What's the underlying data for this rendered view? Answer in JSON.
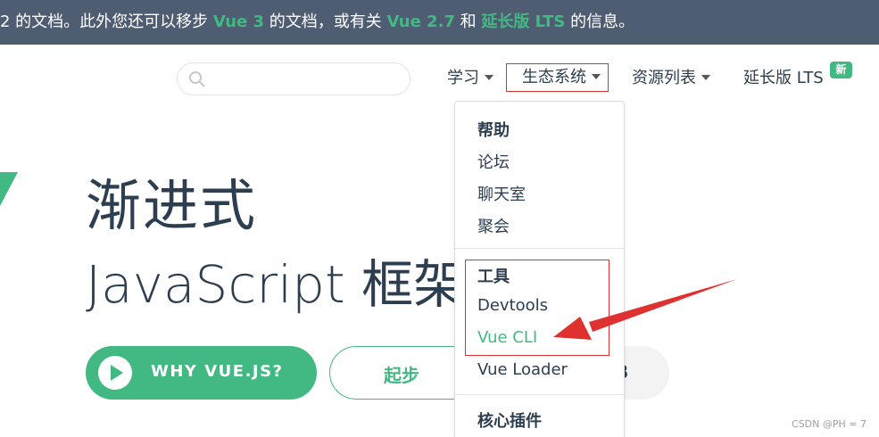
{
  "banner": {
    "part1": "2 的文档。此外您还可以移步 ",
    "link_vue3": "Vue 3",
    "part2": " 的文档，或有关 ",
    "link_vue27": "Vue 2.7",
    "part3": " 和 ",
    "link_lts": "延长版 LTS",
    "part4": " 的信息。"
  },
  "nav": {
    "learn": "学习",
    "ecosystem": "生态系统",
    "resources": "资源列表",
    "lts": "延长版 LTS",
    "lts_badge": "新"
  },
  "hero": {
    "title_line1": "渐进式",
    "title_line2": "JavaScript 框架",
    "why_button": "WHY VUE.JS?",
    "start_button": "起步",
    "third_button": "B"
  },
  "dropdown": {
    "help_heading": "帮助",
    "help_items": [
      "论坛",
      "聊天室",
      "聚会"
    ],
    "tools_heading": "工具",
    "tools_items": [
      "Devtools",
      "Vue CLI",
      "Vue Loader"
    ],
    "plugins_heading": "核心插件"
  },
  "watermark": "CSDN @PH = 7",
  "colors": {
    "accent": "#42b983",
    "banner_bg": "#4f5d73",
    "annotation_red": "#e03131"
  }
}
